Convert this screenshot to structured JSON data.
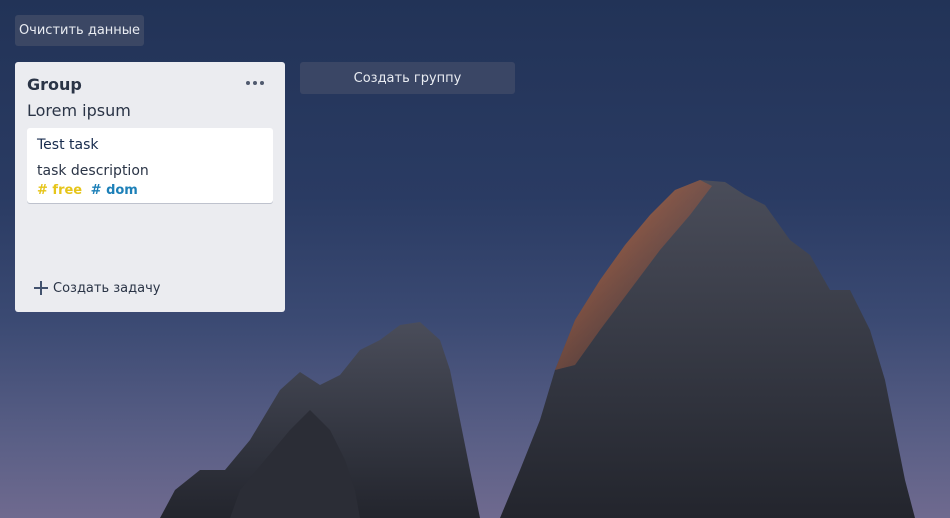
{
  "toolbar": {
    "clear_label": "Очистить данные",
    "create_group_label": "Создать группу"
  },
  "groups": [
    {
      "title": "Group",
      "subtitle": "Lorem ipsum",
      "menu_icon": "more-horizontal-icon",
      "tasks": [
        {
          "title": "Test task",
          "description": "task description",
          "tags": [
            {
              "text": "# free",
              "color": "#e6c51a"
            },
            {
              "text": "# dom",
              "color": "#1d80b8"
            }
          ]
        }
      ],
      "add_task_label": "Создать задачу",
      "add_task_icon": "plus-icon"
    }
  ],
  "background": {
    "image": "mountain-peaks-dusk",
    "sky_color": "#223357",
    "card_color": "#ebecf0"
  }
}
